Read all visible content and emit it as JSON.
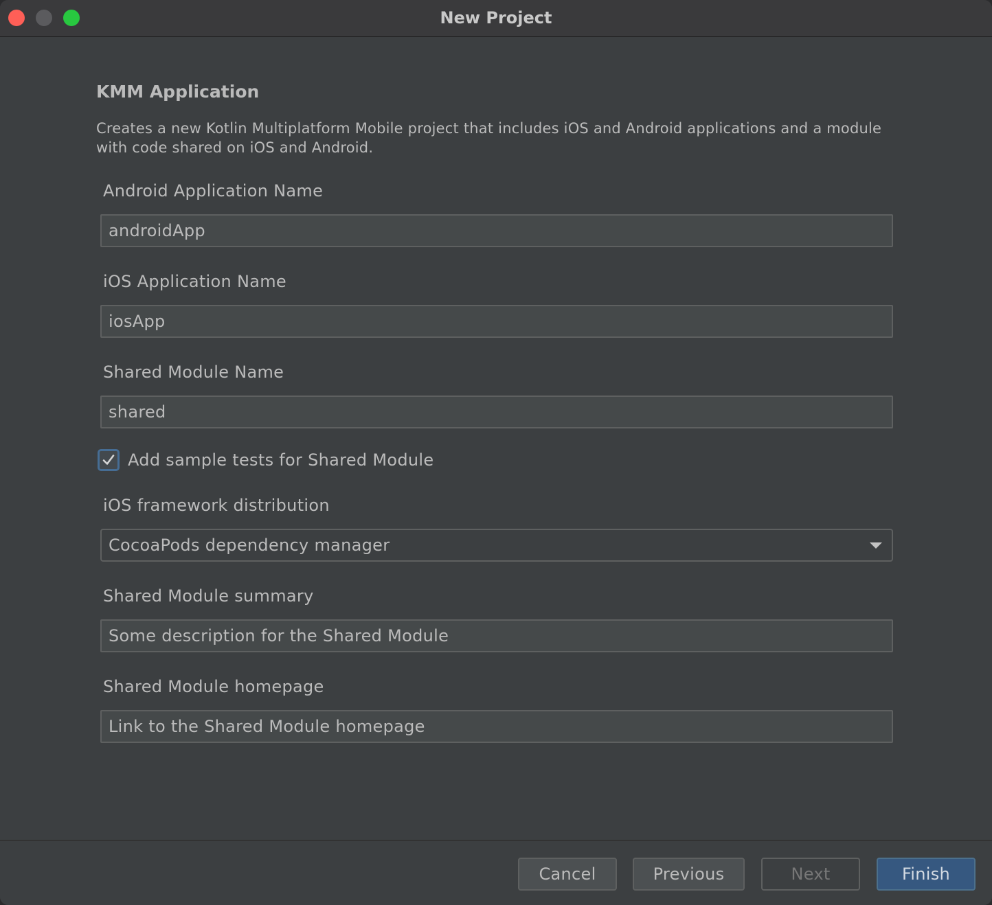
{
  "window": {
    "title": "New Project"
  },
  "header": {
    "heading": "KMM Application",
    "description": "Creates a new Kotlin Multiplatform Mobile project that includes iOS and Android applications and a module with code shared on iOS and Android."
  },
  "form": {
    "android_app_name": {
      "label": "Android Application Name",
      "value": "androidApp"
    },
    "ios_app_name": {
      "label": "iOS Application Name",
      "value": "iosApp"
    },
    "shared_module_name": {
      "label": "Shared Module Name",
      "value": "shared"
    },
    "sample_tests": {
      "label": "Add sample tests for Shared Module",
      "checked": true
    },
    "ios_framework_distribution": {
      "label": "iOS framework distribution",
      "selected": "CocoaPods dependency manager"
    },
    "shared_module_summary": {
      "label": "Shared Module summary",
      "placeholder": "Some description for the Shared Module"
    },
    "shared_module_homepage": {
      "label": "Shared Module homepage",
      "placeholder": "Link to the Shared Module homepage"
    }
  },
  "footer": {
    "cancel_label": "Cancel",
    "previous_label": "Previous",
    "next_label": "Next",
    "finish_label": "Finish"
  },
  "colors": {
    "background": "#3c3f41",
    "accent": "#365880",
    "text": "#bbbbbb"
  }
}
